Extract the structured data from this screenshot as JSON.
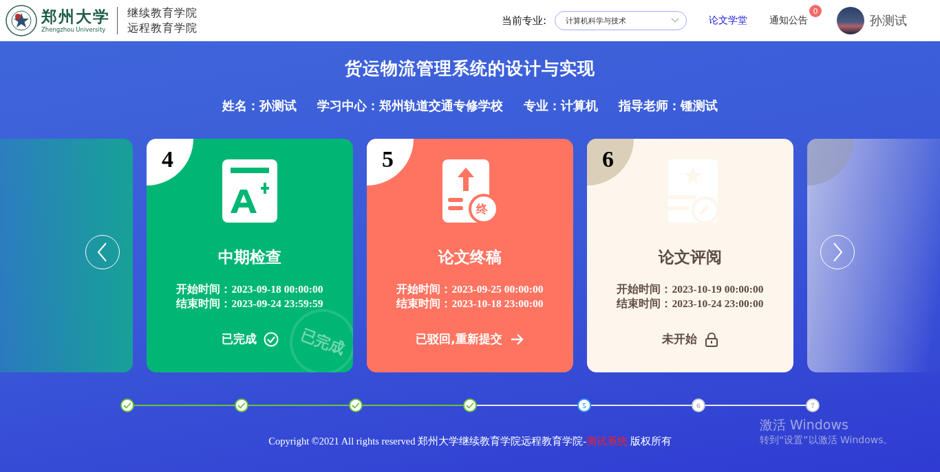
{
  "header": {
    "logo_title": "郑州大学",
    "logo_subtitle": "Zhengzhou University",
    "school_lines": [
      "继续教育学院",
      "远程教育学院"
    ],
    "major_label": "当前专业:",
    "major_select": {
      "value": "计算机科学与技术"
    },
    "nav_links": [
      {
        "label": "论文学堂",
        "selected": true
      },
      {
        "label": "通知公告",
        "selected": false,
        "badge": "0"
      }
    ],
    "user_name": "孙测试"
  },
  "title": "货运物流管理系统的设计与实现",
  "info": [
    "姓名：孙测试",
    "学习中心：郑州轨道交通专修学校",
    "专业：计算机",
    "指导老师：锺测试"
  ],
  "cards": [
    {
      "number": "4",
      "kind": "grade",
      "color": "#00b674",
      "title": "中期检查",
      "start": "开始时间：2023-09-18 00:00:00",
      "end": "结束时间：2023-09-24 23:59:59",
      "status_text": "已完成",
      "stamp": "已完成"
    },
    {
      "number": "5",
      "kind": "final",
      "color": "#ff7461",
      "title": "论文终稿",
      "icon_badge": "终",
      "start": "开始时间：2023-09-25 00:00:00",
      "end": "结束时间：2023-10-18 23:00:00",
      "status_text": "已驳回,重新提交"
    },
    {
      "number": "6",
      "kind": "review",
      "color": "#fdf6ec",
      "title": "论文评阅",
      "start": "开始时间：2023-10-19 00:00:00",
      "end": "结束时间：2023-10-24 23:00:00",
      "status_text": "未开始"
    }
  ],
  "steps": [
    {
      "done": true,
      "current": false
    },
    {
      "done": true,
      "current": false
    },
    {
      "done": true,
      "current": false
    },
    {
      "done": true,
      "current": false
    },
    {
      "done": false,
      "current": true,
      "label": "5"
    },
    {
      "done": false,
      "current": false,
      "label": "6"
    },
    {
      "done": false,
      "current": false,
      "label": "7"
    }
  ],
  "footer": {
    "before": "Copyright ©2021 All rights reserved 郑州大学继续教育学院远程教育学院-",
    "highlight": "测试系统",
    "after": " 版权所有"
  },
  "os_notice": {
    "title": "激活 Windows",
    "text": "转到“设置”以激活 Windows。"
  }
}
